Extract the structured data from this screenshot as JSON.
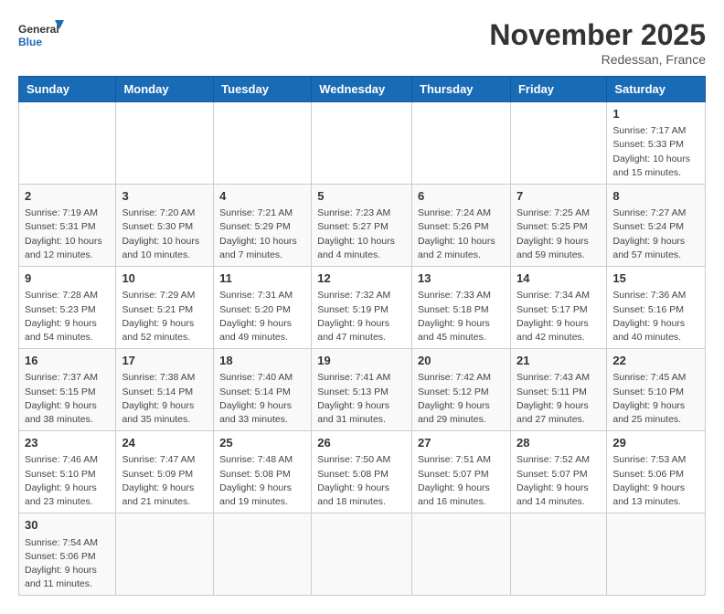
{
  "header": {
    "logo_general": "General",
    "logo_blue": "Blue",
    "month_title": "November 2025",
    "location": "Redessan, France"
  },
  "weekdays": [
    "Sunday",
    "Monday",
    "Tuesday",
    "Wednesday",
    "Thursday",
    "Friday",
    "Saturday"
  ],
  "weeks": [
    [
      {
        "day": "",
        "info": ""
      },
      {
        "day": "",
        "info": ""
      },
      {
        "day": "",
        "info": ""
      },
      {
        "day": "",
        "info": ""
      },
      {
        "day": "",
        "info": ""
      },
      {
        "day": "",
        "info": ""
      },
      {
        "day": "1",
        "info": "Sunrise: 7:17 AM\nSunset: 5:33 PM\nDaylight: 10 hours\nand 15 minutes."
      }
    ],
    [
      {
        "day": "2",
        "info": "Sunrise: 7:19 AM\nSunset: 5:31 PM\nDaylight: 10 hours\nand 12 minutes."
      },
      {
        "day": "3",
        "info": "Sunrise: 7:20 AM\nSunset: 5:30 PM\nDaylight: 10 hours\nand 10 minutes."
      },
      {
        "day": "4",
        "info": "Sunrise: 7:21 AM\nSunset: 5:29 PM\nDaylight: 10 hours\nand 7 minutes."
      },
      {
        "day": "5",
        "info": "Sunrise: 7:23 AM\nSunset: 5:27 PM\nDaylight: 10 hours\nand 4 minutes."
      },
      {
        "day": "6",
        "info": "Sunrise: 7:24 AM\nSunset: 5:26 PM\nDaylight: 10 hours\nand 2 minutes."
      },
      {
        "day": "7",
        "info": "Sunrise: 7:25 AM\nSunset: 5:25 PM\nDaylight: 9 hours\nand 59 minutes."
      },
      {
        "day": "8",
        "info": "Sunrise: 7:27 AM\nSunset: 5:24 PM\nDaylight: 9 hours\nand 57 minutes."
      }
    ],
    [
      {
        "day": "9",
        "info": "Sunrise: 7:28 AM\nSunset: 5:23 PM\nDaylight: 9 hours\nand 54 minutes."
      },
      {
        "day": "10",
        "info": "Sunrise: 7:29 AM\nSunset: 5:21 PM\nDaylight: 9 hours\nand 52 minutes."
      },
      {
        "day": "11",
        "info": "Sunrise: 7:31 AM\nSunset: 5:20 PM\nDaylight: 9 hours\nand 49 minutes."
      },
      {
        "day": "12",
        "info": "Sunrise: 7:32 AM\nSunset: 5:19 PM\nDaylight: 9 hours\nand 47 minutes."
      },
      {
        "day": "13",
        "info": "Sunrise: 7:33 AM\nSunset: 5:18 PM\nDaylight: 9 hours\nand 45 minutes."
      },
      {
        "day": "14",
        "info": "Sunrise: 7:34 AM\nSunset: 5:17 PM\nDaylight: 9 hours\nand 42 minutes."
      },
      {
        "day": "15",
        "info": "Sunrise: 7:36 AM\nSunset: 5:16 PM\nDaylight: 9 hours\nand 40 minutes."
      }
    ],
    [
      {
        "day": "16",
        "info": "Sunrise: 7:37 AM\nSunset: 5:15 PM\nDaylight: 9 hours\nand 38 minutes."
      },
      {
        "day": "17",
        "info": "Sunrise: 7:38 AM\nSunset: 5:14 PM\nDaylight: 9 hours\nand 35 minutes."
      },
      {
        "day": "18",
        "info": "Sunrise: 7:40 AM\nSunset: 5:14 PM\nDaylight: 9 hours\nand 33 minutes."
      },
      {
        "day": "19",
        "info": "Sunrise: 7:41 AM\nSunset: 5:13 PM\nDaylight: 9 hours\nand 31 minutes."
      },
      {
        "day": "20",
        "info": "Sunrise: 7:42 AM\nSunset: 5:12 PM\nDaylight: 9 hours\nand 29 minutes."
      },
      {
        "day": "21",
        "info": "Sunrise: 7:43 AM\nSunset: 5:11 PM\nDaylight: 9 hours\nand 27 minutes."
      },
      {
        "day": "22",
        "info": "Sunrise: 7:45 AM\nSunset: 5:10 PM\nDaylight: 9 hours\nand 25 minutes."
      }
    ],
    [
      {
        "day": "23",
        "info": "Sunrise: 7:46 AM\nSunset: 5:10 PM\nDaylight: 9 hours\nand 23 minutes."
      },
      {
        "day": "24",
        "info": "Sunrise: 7:47 AM\nSunset: 5:09 PM\nDaylight: 9 hours\nand 21 minutes."
      },
      {
        "day": "25",
        "info": "Sunrise: 7:48 AM\nSunset: 5:08 PM\nDaylight: 9 hours\nand 19 minutes."
      },
      {
        "day": "26",
        "info": "Sunrise: 7:50 AM\nSunset: 5:08 PM\nDaylight: 9 hours\nand 18 minutes."
      },
      {
        "day": "27",
        "info": "Sunrise: 7:51 AM\nSunset: 5:07 PM\nDaylight: 9 hours\nand 16 minutes."
      },
      {
        "day": "28",
        "info": "Sunrise: 7:52 AM\nSunset: 5:07 PM\nDaylight: 9 hours\nand 14 minutes."
      },
      {
        "day": "29",
        "info": "Sunrise: 7:53 AM\nSunset: 5:06 PM\nDaylight: 9 hours\nand 13 minutes."
      }
    ],
    [
      {
        "day": "30",
        "info": "Sunrise: 7:54 AM\nSunset: 5:06 PM\nDaylight: 9 hours\nand 11 minutes."
      },
      {
        "day": "",
        "info": ""
      },
      {
        "day": "",
        "info": ""
      },
      {
        "day": "",
        "info": ""
      },
      {
        "day": "",
        "info": ""
      },
      {
        "day": "",
        "info": ""
      },
      {
        "day": "",
        "info": ""
      }
    ]
  ]
}
